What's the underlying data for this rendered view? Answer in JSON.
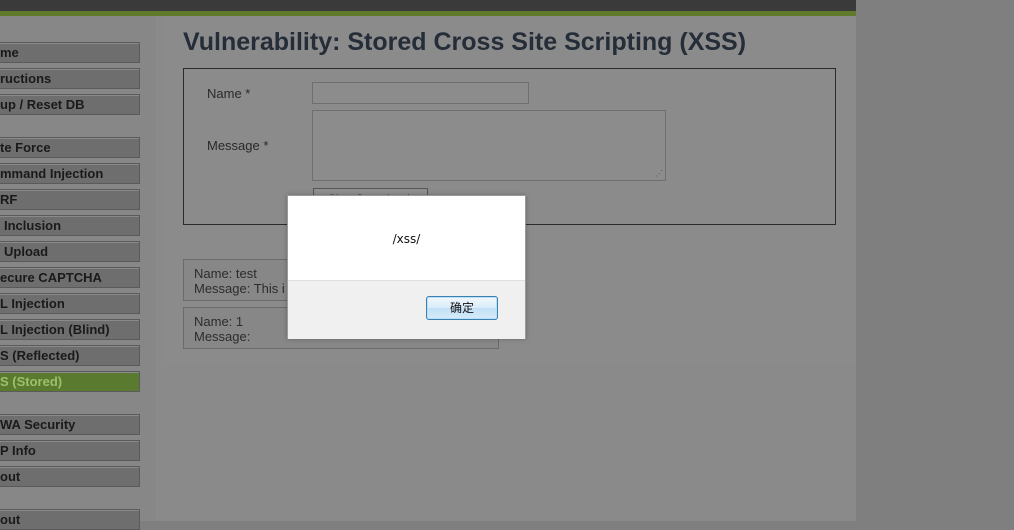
{
  "page": {
    "title": "Vulnerability: Stored Cross Site Scripting (XSS)"
  },
  "sidebar": {
    "items": [
      {
        "label": "me"
      },
      {
        "label": "ructions"
      },
      {
        "label": "up / Reset DB"
      },
      {
        "label": "te Force"
      },
      {
        "label": "mmand Injection"
      },
      {
        "label": "RF"
      },
      {
        "label": "Inclusion"
      },
      {
        "label": "Upload"
      },
      {
        "label": "ecure CAPTCHA"
      },
      {
        "label": "L Injection"
      },
      {
        "label": "L Injection (Blind)"
      },
      {
        "label": "S (Reflected)"
      },
      {
        "label": "S (Stored)",
        "selected": true
      },
      {
        "label": "WA Security"
      },
      {
        "label": "P Info"
      },
      {
        "label": "out"
      },
      {
        "label": "out"
      }
    ]
  },
  "form": {
    "name_label": "Name *",
    "message_label": "Message *",
    "name_value": "",
    "message_value": "",
    "sign_button_label": "Sign Guestbook"
  },
  "entries": [
    {
      "name_line": "Name: test",
      "message_line": "Message: This i"
    },
    {
      "name_line": "Name: 1",
      "message_line": "Message:"
    }
  ],
  "dialog": {
    "message": "/xss/",
    "ok_label": "确定"
  },
  "colors": {
    "selected_item": "#5a7a30",
    "header_accent": "#5e7a2a"
  }
}
